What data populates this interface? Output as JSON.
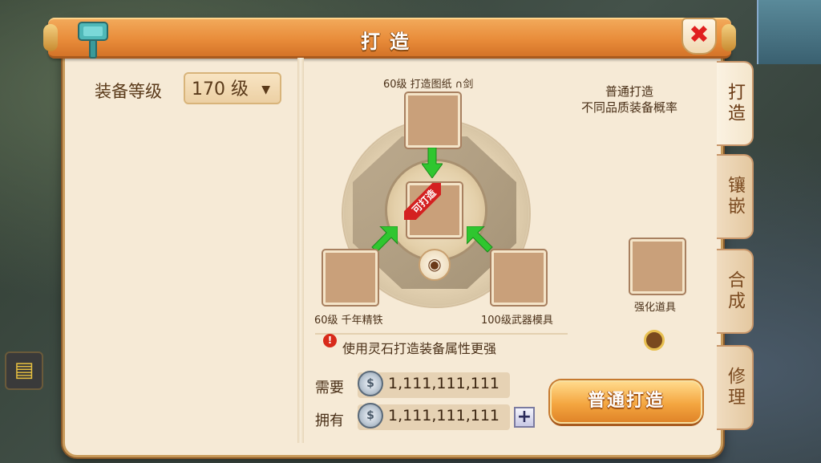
{
  "window": {
    "title": "打造",
    "close_label": "✖"
  },
  "left": {
    "level_label": "装备等级",
    "level_value": "170 级",
    "level_arrow": "▼"
  },
  "forge": {
    "top_caption": "60级 打造图纸 ∩剑",
    "left_caption": "60级 千年精铁",
    "right_caption": "100级武器模具",
    "center_ribbon": "可打造",
    "eye_glyph": "◉"
  },
  "info": {
    "desc_line1": "普通打造",
    "desc_line2": "不同品质装备概率",
    "enhance_caption": "强化道具"
  },
  "hint": {
    "icon": "!",
    "text": "使用灵石打造装备属性更强"
  },
  "resources": {
    "need_label": "需要",
    "need_value": "1,111,111,111",
    "have_label": "拥有",
    "have_value": "1,111,111,111",
    "coin_glyph": "$",
    "plus_label": "+"
  },
  "actions": {
    "forge_button": "普通打造"
  },
  "tabs": [
    {
      "label": "打造",
      "active": true
    },
    {
      "label": "镶嵌",
      "active": false
    },
    {
      "label": "合成",
      "active": false
    },
    {
      "label": "修理",
      "active": false
    }
  ],
  "colors": {
    "title_bar": "#e88c3a",
    "panel_bg": "#f6ead6",
    "slot": "#c9a07a",
    "arrow_green": "#2fc62f",
    "ribbon_red": "#d42020",
    "forge_button": "#f4a640"
  },
  "icons": {
    "title_icon": "hammer-icon",
    "close_icon": "close-icon",
    "warning_icon": "warning-icon",
    "coin_icon": "silver-coin-icon",
    "eye_icon": "eye-icon"
  }
}
